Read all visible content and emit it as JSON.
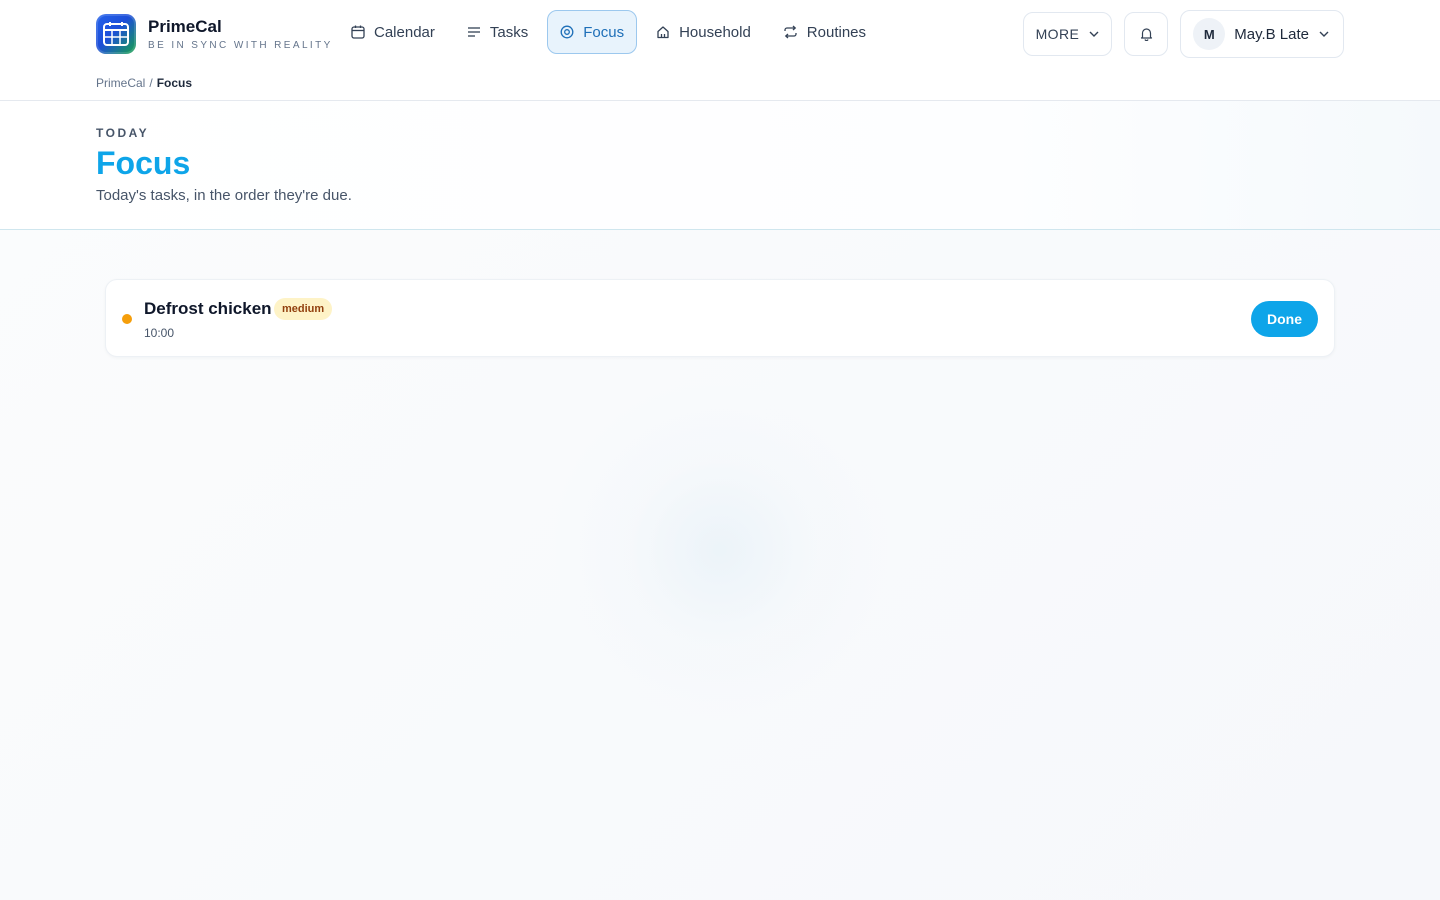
{
  "app": {
    "name": "PrimeCal",
    "tagline": "BE IN SYNC WITH REALITY"
  },
  "nav": {
    "items": [
      {
        "label": "Calendar",
        "icon": "calendar-icon"
      },
      {
        "label": "Tasks",
        "icon": "list-icon"
      },
      {
        "label": "Focus",
        "icon": "target-icon",
        "active": true
      },
      {
        "label": "Household",
        "icon": "home-icon"
      },
      {
        "label": "Routines",
        "icon": "repeat-icon"
      }
    ]
  },
  "toolbar": {
    "more_label": "MORE",
    "user_initial": "M",
    "user_name": "May.B Late"
  },
  "breadcrumb": {
    "root": "PrimeCal",
    "separator": "/",
    "current": "Focus"
  },
  "page": {
    "eyebrow": "TODAY",
    "title": "Focus",
    "subtitle": "Today's tasks, in the order they're due."
  },
  "tasks": [
    {
      "title": "Defrost chicken",
      "priority": "medium",
      "time": "10:00",
      "done_label": "Done"
    }
  ],
  "colors": {
    "accent": "#0ea5e9",
    "priority_medium_dot": "#f59e0b",
    "priority_medium_bg": "#fef3c7",
    "priority_medium_text": "#92400e",
    "done_button": "#0ea5e9"
  }
}
